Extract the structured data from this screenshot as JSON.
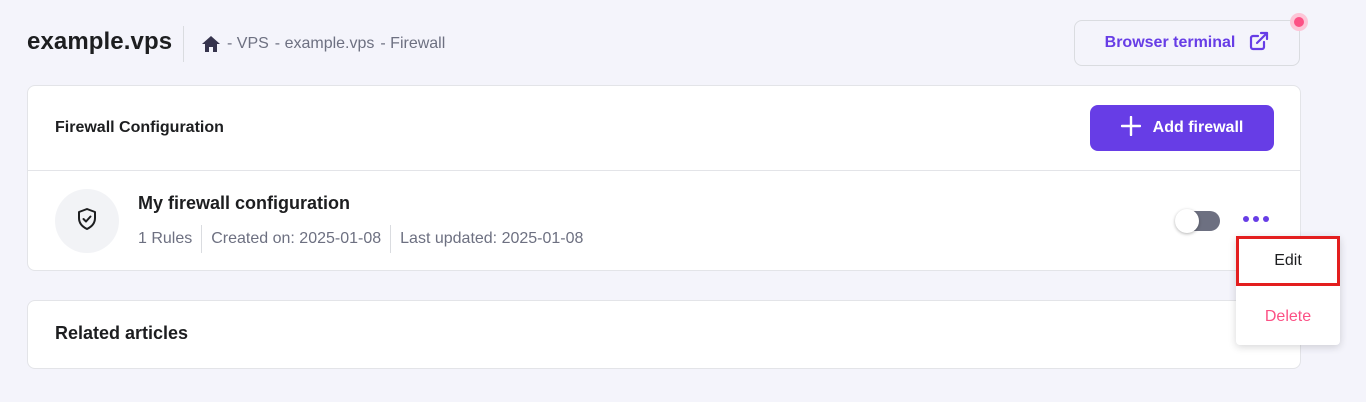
{
  "header": {
    "title": "example.vps",
    "breadcrumb": [
      "- VPS",
      "- example.vps",
      "- Firewall"
    ],
    "terminal_button": "Browser terminal"
  },
  "config_card": {
    "title": "Firewall Configuration",
    "add_button": "Add firewall",
    "firewall": {
      "name": "My firewall configuration",
      "rules": "1 Rules",
      "created": "Created on: 2025-01-08",
      "updated": "Last updated: 2025-01-08",
      "enabled": false
    }
  },
  "articles_card": {
    "title": "Related articles"
  },
  "menu": {
    "edit": "Edit",
    "delete": "Delete"
  },
  "icons": [
    "home-icon",
    "external-link-icon",
    "plus-icon",
    "shield-check-icon",
    "more-dots-icon"
  ],
  "colors": {
    "accent": "#673de6",
    "danger": "#fc5185",
    "muted": "#6d7081",
    "highlight": "#e31e1e"
  }
}
